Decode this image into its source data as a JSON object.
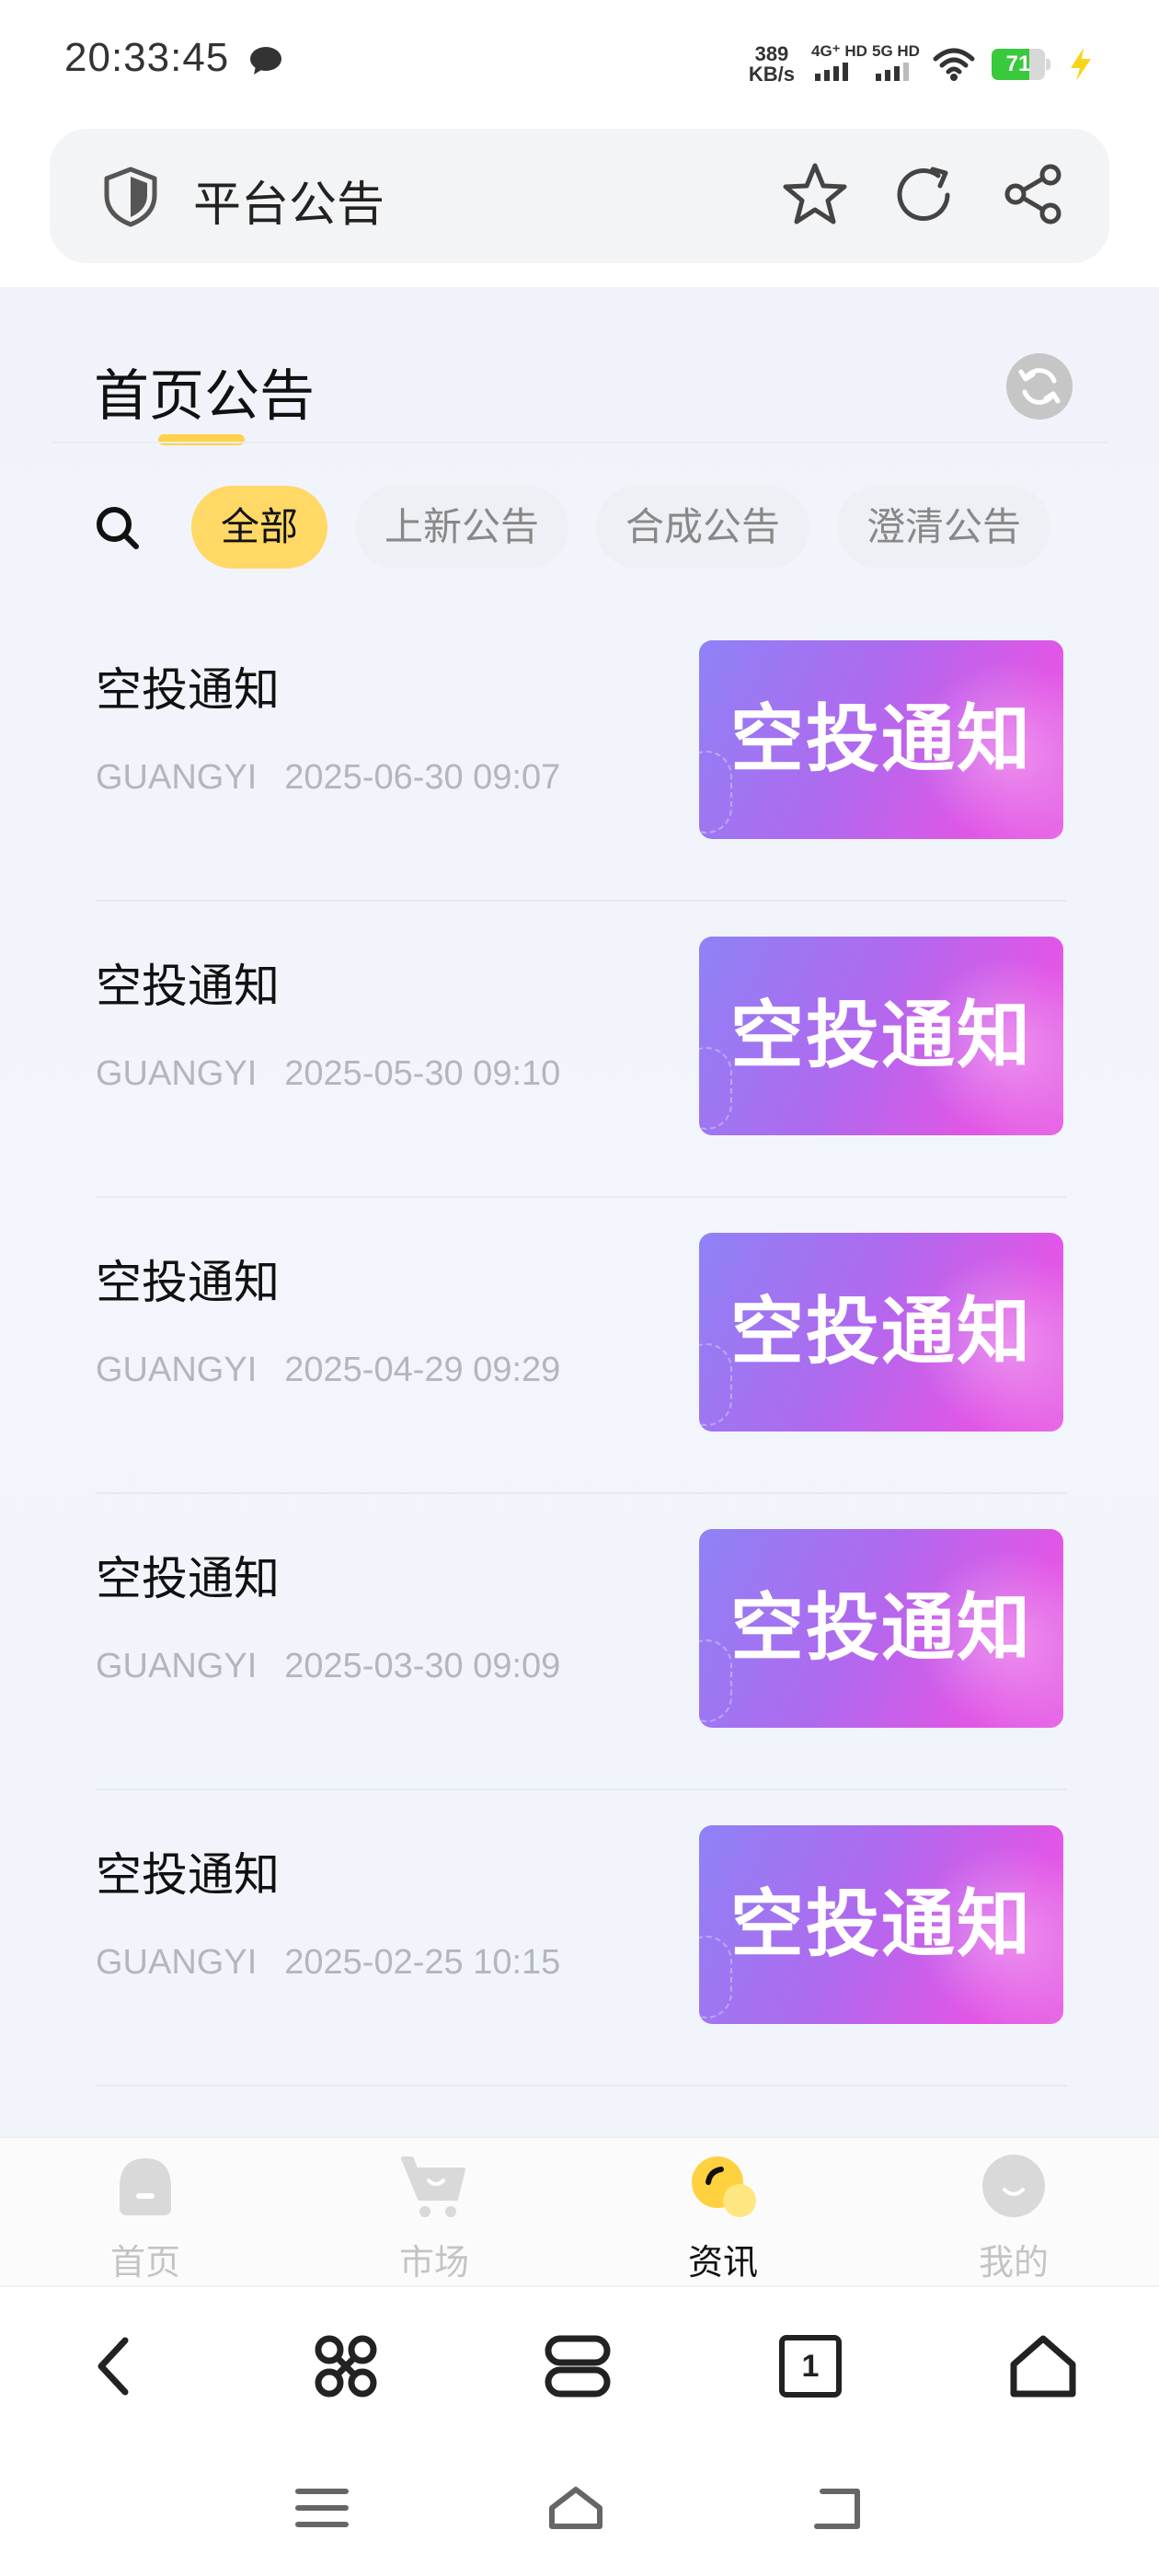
{
  "status_bar": {
    "time": "20:33:45",
    "net_speed_value": "389",
    "net_speed_unit": "KB/s",
    "sim1_label": "4G⁺ HD",
    "sim2_label": "5G HD",
    "battery_level": "71",
    "battery_fraction": 0.71,
    "colors": {
      "battery_fill": "#39c93c",
      "charging": "#f6d51c"
    }
  },
  "address_bar": {
    "title": "平台公告",
    "icons": [
      "shield-icon",
      "star-icon",
      "reload-icon",
      "share-icon"
    ]
  },
  "header": {
    "title": "首页公告",
    "refresh_icon": "refresh-icon",
    "accent_color": "#ffd24a"
  },
  "filter": {
    "search_icon": "search-icon",
    "tabs": [
      {
        "label": "全部",
        "active": true
      },
      {
        "label": "上新公告",
        "active": false
      },
      {
        "label": "合成公告",
        "active": false
      },
      {
        "label": "澄清公告",
        "active": false
      }
    ]
  },
  "notices": [
    {
      "title": "空投通知",
      "source": "GUANGYI",
      "datetime": "2025-06-30 09:07",
      "thumb_text": "空投通知"
    },
    {
      "title": "空投通知",
      "source": "GUANGYI",
      "datetime": "2025-05-30 09:10",
      "thumb_text": "空投通知"
    },
    {
      "title": "空投通知",
      "source": "GUANGYI",
      "datetime": "2025-04-29 09:29",
      "thumb_text": "空投通知"
    },
    {
      "title": "空投通知",
      "source": "GUANGYI",
      "datetime": "2025-03-30 09:09",
      "thumb_text": "空投通知"
    },
    {
      "title": "空投通知",
      "source": "GUANGYI",
      "datetime": "2025-02-25 10:15",
      "thumb_text": "空投通知"
    }
  ],
  "app_nav": {
    "items": [
      {
        "label": "首页",
        "icon": "home-icon",
        "active": false
      },
      {
        "label": "市场",
        "icon": "cart-icon",
        "active": false
      },
      {
        "label": "资讯",
        "icon": "news-icon",
        "active": true
      },
      {
        "label": "我的",
        "icon": "profile-icon",
        "active": false
      }
    ]
  },
  "browser_bar": {
    "tab_count": "1",
    "icons": [
      "back-icon",
      "apps-icon",
      "tabs-icon",
      "tab-count-icon",
      "browser-home-icon"
    ]
  },
  "system_nav": {
    "icons": [
      "menu-icon",
      "system-home-icon",
      "system-back-icon"
    ]
  }
}
